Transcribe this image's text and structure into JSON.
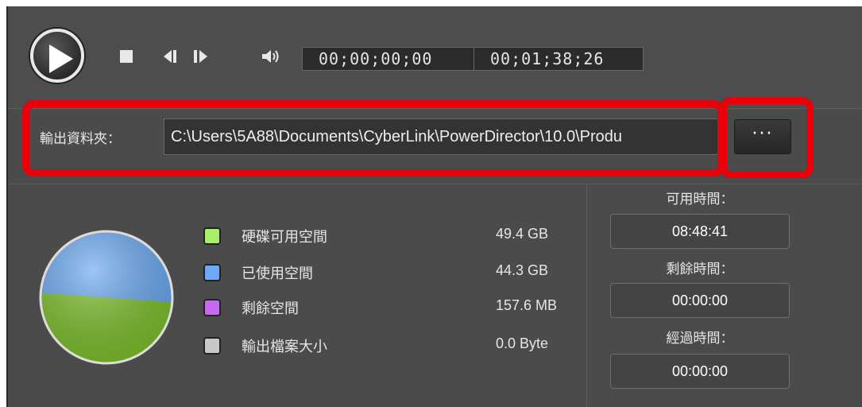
{
  "transport": {
    "current_time": "00;00;00;00",
    "total_time": "00;01;38;26"
  },
  "output": {
    "folder_label": "輸出資料夾：",
    "path": "C:\\Users\\5A88\\Documents\\CyberLink\\PowerDirector\\10.0\\Produ",
    "browse_label": "···"
  },
  "disk": {
    "legend": [
      {
        "label": "硬碟可用空間",
        "value": "49.4 GB",
        "color": "#a8ef6c"
      },
      {
        "label": "已使用空間",
        "value": "44.3 GB",
        "color": "#6ea8f8"
      },
      {
        "label": "剩餘空間",
        "value": "157.6 MB",
        "color": "#c46af0"
      },
      {
        "label": "輸出檔案大小",
        "value": "0.0 Byte",
        "color": "#c8c8c8"
      }
    ],
    "pie_colors": {
      "used": "#6aa8f0",
      "free": "#7ec02e"
    }
  },
  "times": {
    "available_label": "可用時間：",
    "available_value": "08:48:41",
    "remaining_label": "剩餘時間：",
    "remaining_value": "00:00:00",
    "elapsed_label": "經過時間：",
    "elapsed_value": "00:00:00"
  },
  "highlight_color": "#e8000b"
}
